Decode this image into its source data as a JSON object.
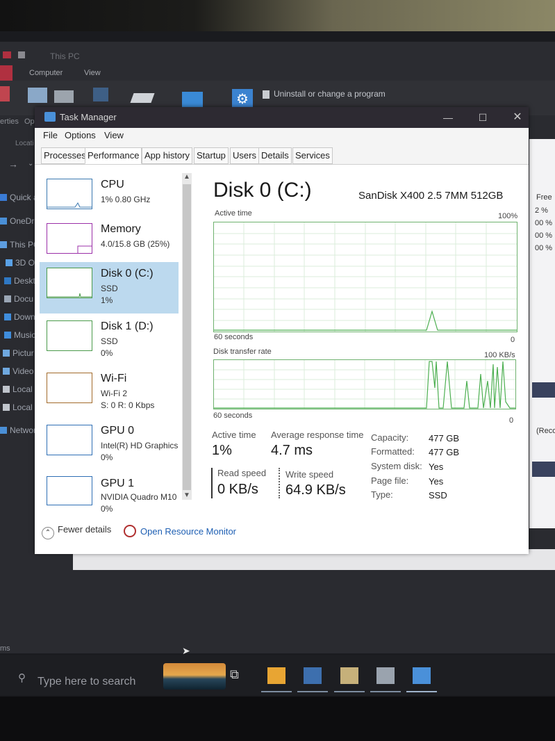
{
  "explorer": {
    "title": "This PC",
    "ribbon_tabs": [
      "Computer",
      "View"
    ],
    "uninstall": "Uninstall or change a program",
    "left_cut_labels": [
      "erties",
      "Ope",
      "Locati"
    ],
    "nav_items": [
      "Quick a",
      "OneDri",
      "This PC",
      "3D Ol",
      "Deskt",
      "Docu",
      "Down",
      "Music",
      "Pictur",
      "Video",
      "Local",
      "Local",
      "Networ"
    ],
    "right_free": [
      "Free",
      "2 %",
      "00 %",
      "00 %",
      "00 %"
    ],
    "right_rec": "(Reco",
    "bottom_left": "ms"
  },
  "task_manager": {
    "title": "Task Manager",
    "menu": [
      "File",
      "Options",
      "View"
    ],
    "tabs": [
      "Processes",
      "Performance",
      "App history",
      "Startup",
      "Users",
      "Details",
      "Services"
    ],
    "active_tab": "Performance",
    "resources": [
      {
        "name": "CPU",
        "s1": "1% 0.80 GHz",
        "s2": ""
      },
      {
        "name": "Memory",
        "s1": "4.0/15.8 GB (25%)",
        "s2": ""
      },
      {
        "name": "Disk 0 (C:)",
        "s1": "SSD",
        "s2": "1%"
      },
      {
        "name": "Disk 1 (D:)",
        "s1": "SSD",
        "s2": "0%"
      },
      {
        "name": "Wi-Fi",
        "s1": "Wi-Fi 2",
        "s2": "S: 0 R: 0 Kbps"
      },
      {
        "name": "GPU 0",
        "s1": "Intel(R) HD Graphics",
        "s2": "0%"
      },
      {
        "name": "GPU 1",
        "s1": "NVIDIA Quadro M10",
        "s2": "0%"
      }
    ],
    "selected_index": 2,
    "detail": {
      "title": "Disk 0 (C:)",
      "model": "SanDisk X400 2.5 7MM 512GB",
      "graph1": {
        "label": "Active time",
        "max": "100%",
        "xlabel": "60 seconds",
        "min": "0"
      },
      "graph2": {
        "label": "Disk transfer rate",
        "max": "100 KB/s",
        "xlabel": "60 seconds",
        "min": "0"
      },
      "active_time_label": "Active time",
      "active_time_value": "1%",
      "avg_resp_label": "Average response time",
      "avg_resp_value": "4.7 ms",
      "read_label": "Read speed",
      "read_value": "0 KB/s",
      "write_label": "Write speed",
      "write_value": "64.9 KB/s",
      "props": [
        {
          "label": "Capacity:",
          "value": "477 GB"
        },
        {
          "label": "Formatted:",
          "value": "477 GB"
        },
        {
          "label": "System disk:",
          "value": "Yes"
        },
        {
          "label": "Page file:",
          "value": "Yes"
        },
        {
          "label": "Type:",
          "value": "SSD"
        }
      ]
    },
    "fewer_details": "Fewer details",
    "open_resource_monitor": "Open Resource Monitor"
  },
  "taskbar": {
    "search_placeholder": "Type here to search"
  },
  "colors": {
    "graph_green": "#4caf50",
    "graph_border": "#6fb26f",
    "selected_bg": "#bcd9ee",
    "link_blue": "#1e5fb3"
  }
}
